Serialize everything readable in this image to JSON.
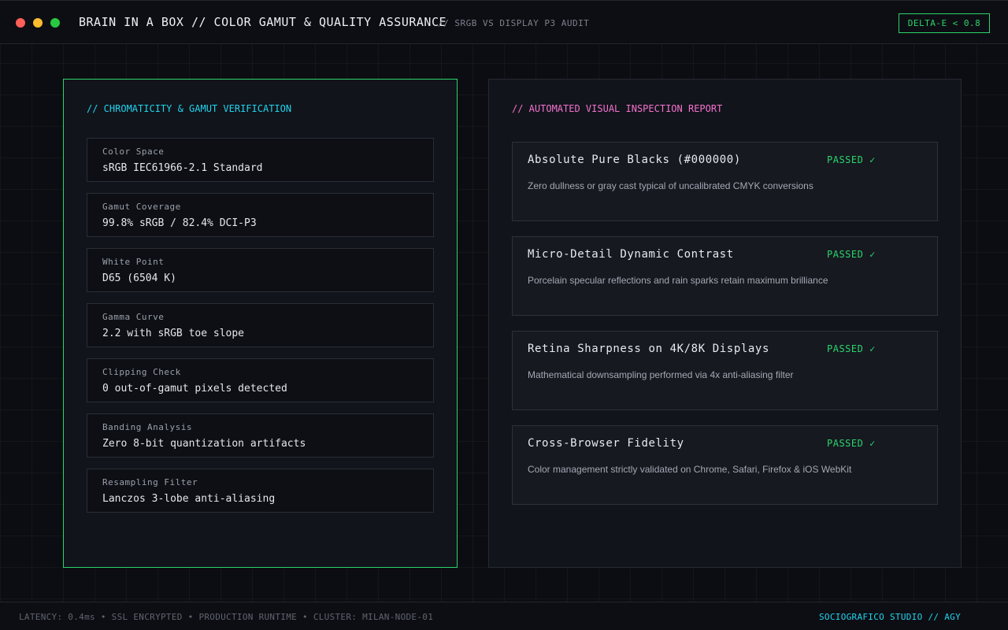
{
  "window": {
    "controls": [
      "close-dot",
      "minimize-dot",
      "maximize-dot"
    ],
    "title": "BRAIN IN A BOX // COLOR GAMUT & QUALITY ASSURANCE",
    "subtitle": "// SRGB VS DISPLAY P3 AUDIT",
    "badge": "DELTA-E < 0.8"
  },
  "gamut_panel": {
    "heading": "// CHROMATICITY & GAMUT VERIFICATION",
    "metrics": [
      {
        "label": "Color Space",
        "value": "sRGB IEC61966-2.1 Standard"
      },
      {
        "label": "Gamut Coverage",
        "value": "99.8% sRGB / 82.4% DCI-P3"
      },
      {
        "label": "White Point",
        "value": "D65 (6504 K)"
      },
      {
        "label": "Gamma Curve",
        "value": "2.2 with sRGB toe slope"
      },
      {
        "label": "Clipping Check",
        "value": "0 out-of-gamut pixels detected"
      },
      {
        "label": "Banding Analysis",
        "value": "Zero 8-bit quantization artifacts"
      },
      {
        "label": "Resampling Filter",
        "value": "Lanczos 3-lobe anti-aliasing"
      }
    ]
  },
  "inspection_panel": {
    "heading": "// AUTOMATED VISUAL INSPECTION REPORT",
    "checks": [
      {
        "title": "Absolute Pure Blacks (#000000)",
        "status": "PASSED ✓",
        "description": "Zero dullness or gray cast typical of uncalibrated CMYK conversions"
      },
      {
        "title": "Micro-Detail Dynamic Contrast",
        "status": "PASSED ✓",
        "description": "Porcelain specular reflections and rain sparks retain maximum brilliance"
      },
      {
        "title": "Retina Sharpness on 4K/8K Displays",
        "status": "PASSED ✓",
        "description": "Mathematical downsampling performed via 4x anti-aliasing filter"
      },
      {
        "title": "Cross-Browser Fidelity",
        "status": "PASSED ✓",
        "description": "Color management strictly validated on Chrome, Safari, Firefox & iOS WebKit"
      }
    ]
  },
  "footer": {
    "status": "LATENCY: 0.4ms • SSL ENCRYPTED • PRODUCTION RUNTIME • CLUSTER: MILAN-NODE-01",
    "credit": "SOCIOGRAFICO STUDIO // AGY"
  },
  "colors": {
    "background": "#0c0d12",
    "accent_green": "#2bd46c",
    "accent_cyan": "#22d3ee",
    "accent_pink": "#f472d0"
  }
}
